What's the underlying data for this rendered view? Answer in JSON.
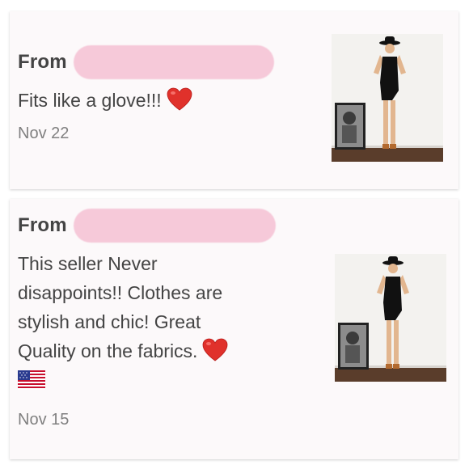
{
  "reviews": [
    {
      "from_label": "From",
      "message": "Fits like a glove!!!",
      "date": "Nov 22",
      "has_flag": false
    },
    {
      "from_label": "From",
      "message_lines": [
        "This seller Never",
        "disappoints!! Clothes are",
        "stylish and chic! Great",
        "Quality on the fabrics."
      ],
      "date": "Nov 15",
      "has_flag": true
    }
  ],
  "icons": {
    "heart": "red-heart-icon",
    "flag": "us-flag-icon"
  },
  "colors": {
    "card_bg": "#fcf9fa",
    "redaction": "#f6c9d9",
    "heart": "#e0312b",
    "text": "#444444",
    "date": "#808080"
  }
}
